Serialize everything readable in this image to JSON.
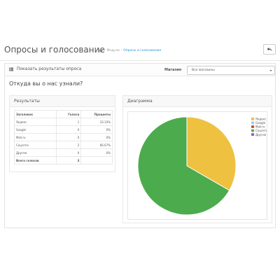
{
  "header": {
    "title": "Опросы и голосование",
    "breadcrumb": [
      "Модули",
      "Опросы и голосование"
    ],
    "icons": {
      "home": "home-icon",
      "back": "reply-arrow-icon"
    }
  },
  "panel": {
    "heading": "Показать результаты опроса",
    "heading_icon": "list-icon",
    "store_label": "Магазин",
    "store_value": "Все магазины"
  },
  "question": "Откуда вы о нас узнали?",
  "results": {
    "heading": "Результаты",
    "columns": [
      "Заголовок",
      "Голоса",
      "Проценты"
    ],
    "rows": [
      {
        "answer": "Яндекс",
        "votes": "1",
        "percent": "33.33%"
      },
      {
        "answer": "Google",
        "votes": "0",
        "percent": "0%"
      },
      {
        "answer": "Mail.ru",
        "votes": "0",
        "percent": "0%"
      },
      {
        "answer": "Соцсети",
        "votes": "2",
        "percent": "66.67%"
      },
      {
        "answer": "Другие",
        "votes": "0",
        "percent": "0%"
      }
    ],
    "total_label": "Всего голосов",
    "total_votes": "3"
  },
  "chart_panel": {
    "heading": "Диаграмма"
  },
  "chart_data": {
    "type": "pie",
    "title": "",
    "legend_position": "top-right",
    "series": [
      {
        "name": "Яндекс",
        "value": 1,
        "color": "#efc140"
      },
      {
        "name": "Google",
        "value": 0,
        "color": "#9dcdea"
      },
      {
        "name": "Mail.ru",
        "value": 0,
        "color": "#c0392b"
      },
      {
        "name": "Соцсети",
        "value": 2,
        "color": "#4cab4c"
      },
      {
        "name": "Другие",
        "value": 0,
        "color": "#8a4ec8"
      }
    ]
  }
}
